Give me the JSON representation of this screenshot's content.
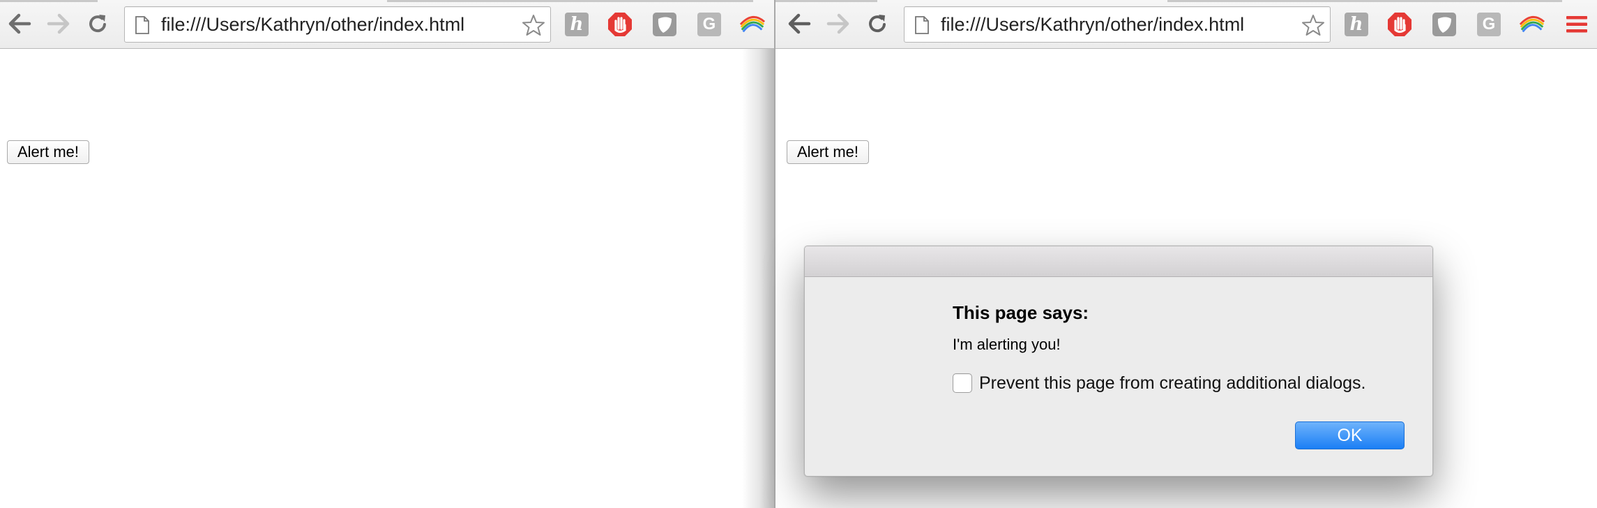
{
  "left_window": {
    "address_bar": {
      "url": "file:///Users/Kathryn/other/index.html"
    },
    "page": {
      "button_label": "Alert me!"
    },
    "extensions": {
      "h_label": "h",
      "g_label": "G"
    }
  },
  "right_window": {
    "address_bar": {
      "url": "file:///Users/Kathryn/other/index.html"
    },
    "page": {
      "button_label": "Alert me!"
    },
    "extensions": {
      "h_label": "h",
      "g_label": "G"
    }
  },
  "alert_dialog": {
    "title": "This page says:",
    "message": "I'm alerting you!",
    "checkbox_label": "Prevent this page from creating additional dialogs.",
    "checkbox_checked": false,
    "ok_label": "OK"
  },
  "colors": {
    "ok_button": "#1b7ff5",
    "adblock_red": "#e53935",
    "menu_red": "#e53935"
  }
}
